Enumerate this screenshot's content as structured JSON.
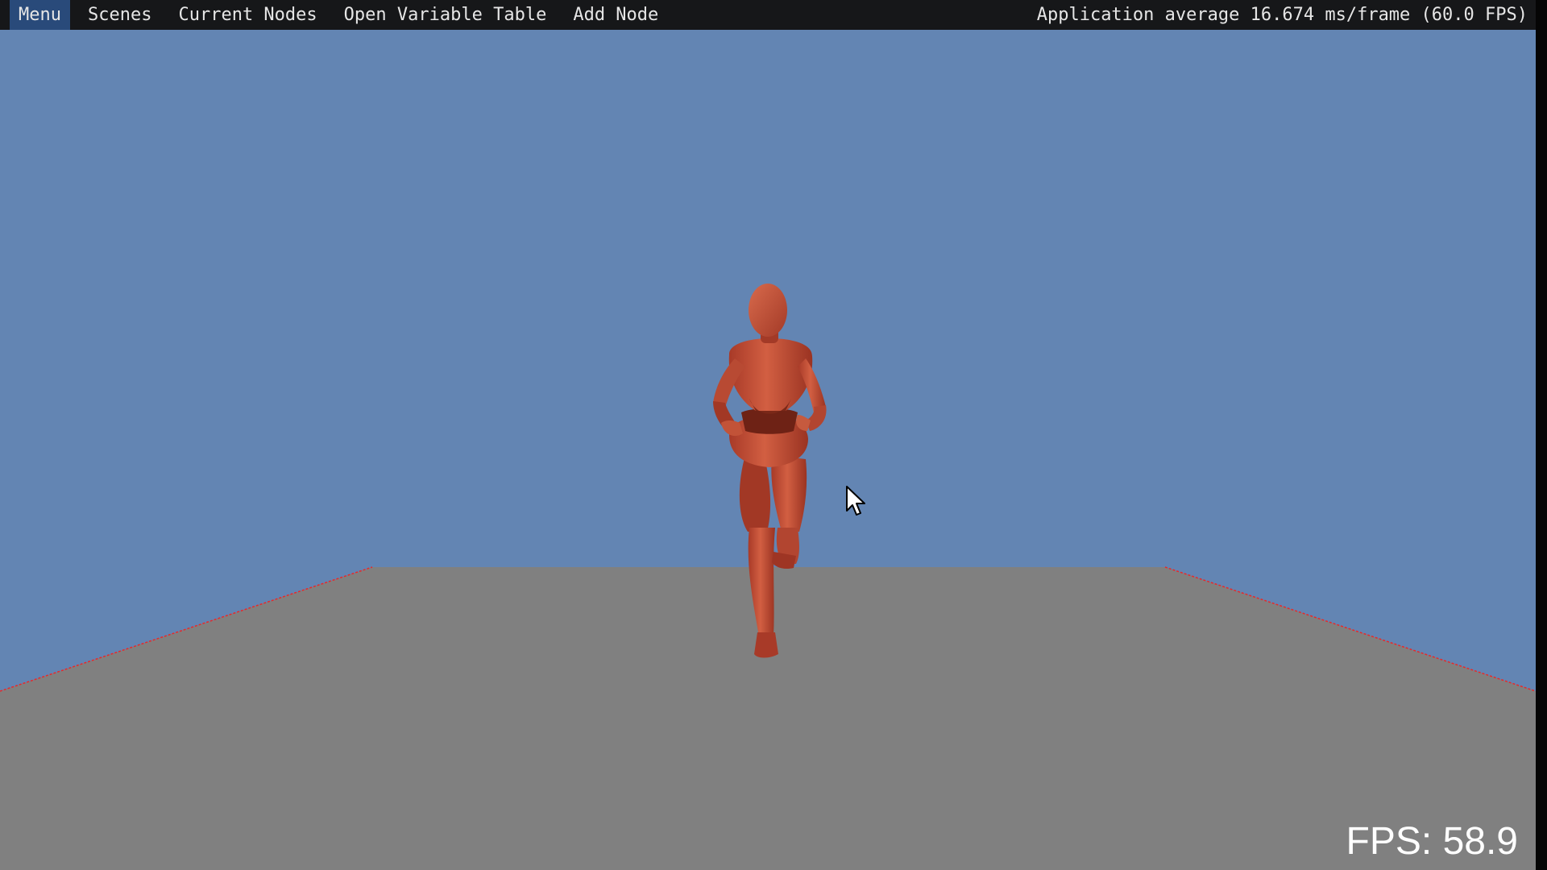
{
  "menubar": {
    "items": [
      {
        "label": "Menu",
        "active": true
      },
      {
        "label": "Scenes",
        "active": false
      },
      {
        "label": "Current Nodes",
        "active": false
      },
      {
        "label": "Open Variable Table",
        "active": false
      },
      {
        "label": "Add Node",
        "active": false
      }
    ],
    "perf_text": "Application average 16.674 ms/frame (60.0 FPS)"
  },
  "overlay": {
    "fps_text": "FPS: 58.9"
  },
  "scene": {
    "sky_color": "#6385b3",
    "floor_color": "#808080",
    "grid_line_color": "#e8282a",
    "character_color": "#c9553a",
    "character_pose": "running"
  },
  "icons": {
    "cursor": "mouse-pointer-icon"
  },
  "colors": {
    "menubar_bg": "#161719",
    "menu_active_bg": "#294a7a",
    "menu_text": "#e6e6e6"
  }
}
